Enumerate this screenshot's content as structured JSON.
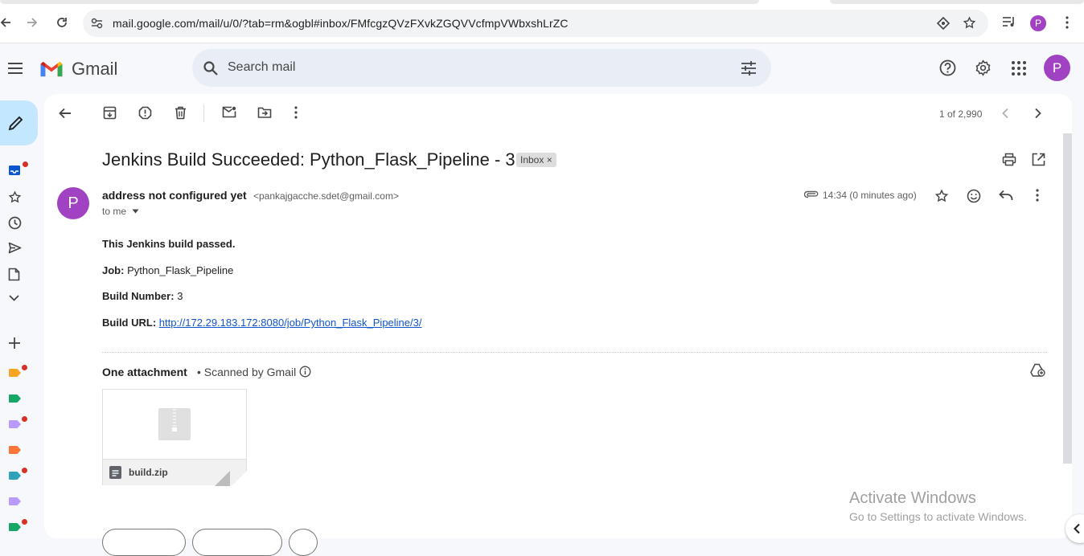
{
  "browser": {
    "url": "mail.google.com/mail/u/0/?tab=rm&ogbl#inbox/FMfcgzQVzFXvkZGQVVcfmpVWbxshLrZC",
    "avatar_letter": "P"
  },
  "header": {
    "app_name": "Gmail",
    "search_placeholder": "Search mail",
    "avatar_letter": "P"
  },
  "toolbar": {
    "pager": "1 of 2,990"
  },
  "message": {
    "subject": "Jenkins Build Succeeded: Python_Flask_Pipeline - 3",
    "label_chip": "Inbox",
    "label_chip_close": "×",
    "sender_avatar_letter": "P",
    "sender_name": "address not configured yet",
    "sender_email": "<pankajgacche.sdet@gmail.com>",
    "recipient": "to me",
    "time": "14:34 (0 minutes ago)",
    "body": {
      "intro": "This Jenkins build passed.",
      "job_label": "Job:",
      "job_value": "Python_Flask_Pipeline",
      "build_number_label": "Build Number:",
      "build_number_value": "3",
      "build_url_label": "Build URL:",
      "build_url_value": "http://172.29.183.172:8080/job/Python_Flask_Pipeline/3/"
    },
    "attachments": {
      "title": "One attachment",
      "scan_note": "• Scanned by Gmail",
      "file_name": "build.zip"
    }
  },
  "watermark": {
    "title": "Activate Windows",
    "subtitle": "Go to Settings to activate Windows."
  },
  "colors": {
    "accent": "#0b57d0",
    "avatar": "#a142c3",
    "compose_bg": "#c2e7ff",
    "notification_dot": "#d93025",
    "link": "#1155cc"
  },
  "labels": [
    {
      "color": "#f6a623",
      "has_dot": true
    },
    {
      "color": "#16a765",
      "has_dot": false
    },
    {
      "color": "#b99aff",
      "has_dot": true
    },
    {
      "color": "#ff7537",
      "has_dot": false
    },
    {
      "color": "#2da2bb",
      "has_dot": true
    },
    {
      "color": "#b99aff",
      "has_dot": false
    },
    {
      "color": "#16a765",
      "has_dot": true
    }
  ]
}
